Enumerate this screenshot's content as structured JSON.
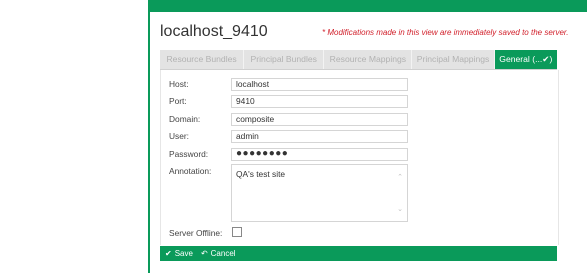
{
  "header": {
    "title": "localhost_9410",
    "notice": "* Modifications made in this view are immediately saved to the server."
  },
  "tabs": [
    {
      "label": "Resource Bundles",
      "active": false
    },
    {
      "label": "Principal Bundles",
      "active": false
    },
    {
      "label": "Resource Mappings",
      "active": false
    },
    {
      "label": "Principal Mappings",
      "active": false
    },
    {
      "label": "General (...✔)",
      "active": true
    }
  ],
  "form": {
    "host": {
      "label": "Host:",
      "value": "localhost"
    },
    "port": {
      "label": "Port:",
      "value": "9410"
    },
    "domain": {
      "label": "Domain:",
      "value": "composite"
    },
    "user": {
      "label": "User:",
      "value": "admin"
    },
    "password": {
      "label": "Password:",
      "value": "●●●●●●●●"
    },
    "annotation": {
      "label": "Annotation:",
      "value": "QA's test site"
    },
    "server_offline": {
      "label": "Server Offline:",
      "checked": false
    }
  },
  "actions": {
    "save_label": "Save",
    "cancel_label": "Cancel"
  },
  "colors": {
    "accent": "#0a9a5a",
    "notice": "#d11f2a",
    "tab_inactive_bg": "#e3e3e3"
  }
}
